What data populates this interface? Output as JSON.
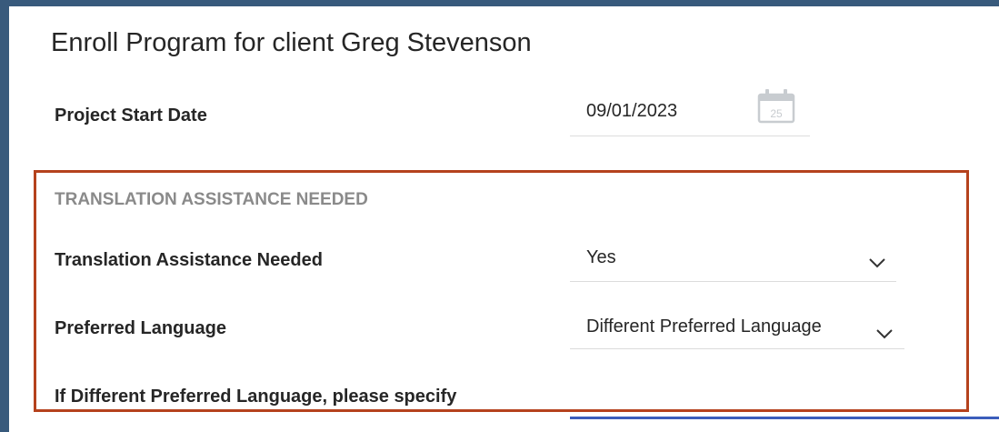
{
  "page": {
    "title": "Enroll Program for client Greg Stevenson"
  },
  "project_start": {
    "label": "Project Start Date",
    "value": "09/01/2023",
    "calendar_day": "25"
  },
  "section": {
    "title": "TRANSLATION ASSISTANCE NEEDED",
    "translation_label": "Translation Assistance Needed",
    "translation_value": "Yes",
    "language_label": "Preferred Language",
    "language_value": "Different Preferred Language",
    "specify_label": "If Different Preferred Language, please specify"
  },
  "colors": {
    "frame": "#385a7c",
    "highlight_border": "#b5421d",
    "section_title": "#8a8a8a"
  },
  "icons": {
    "calendar": "calendar-icon",
    "dropdown": "chevron-down-icon"
  }
}
